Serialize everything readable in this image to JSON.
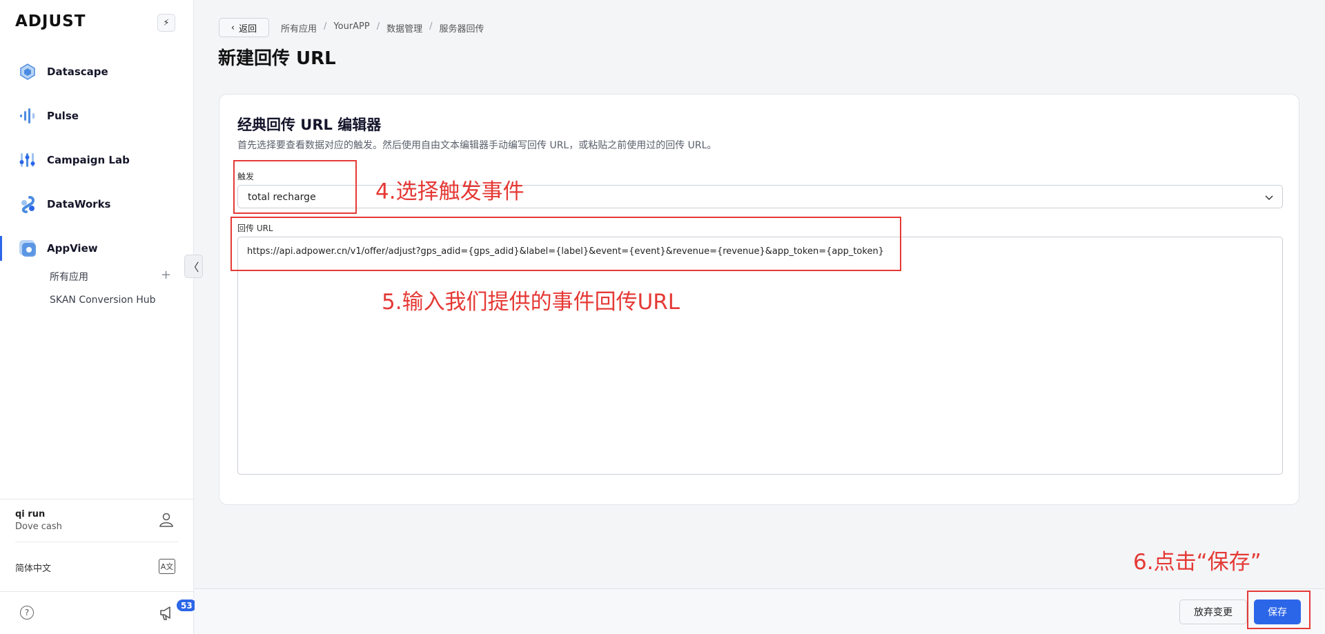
{
  "sidebar": {
    "logo": "ADJUST",
    "nav": [
      {
        "label": "Datascape",
        "icon": "datascape-icon"
      },
      {
        "label": "Pulse",
        "icon": "pulse-icon"
      },
      {
        "label": "Campaign Lab",
        "icon": "campaign-lab-icon"
      },
      {
        "label": "DataWorks",
        "icon": "dataworks-icon"
      },
      {
        "label": "AppView",
        "icon": "appview-icon"
      }
    ],
    "sub_items": [
      {
        "label": "所有应用"
      },
      {
        "label": "SKAN Conversion Hub"
      }
    ],
    "user": {
      "name": "qi run",
      "org": "Dove cash"
    },
    "language": "简体中文",
    "notification_count": "53"
  },
  "header": {
    "back_label": "返回",
    "breadcrumb": [
      "所有应用",
      "YourAPP",
      "数据管理",
      "服务器回传"
    ],
    "title": "新建回传 URL"
  },
  "editor": {
    "title": "经典回传 URL 编辑器",
    "description": "首先选择要查看数据对应的触发。然后使用自由文本编辑器手动编写回传 URL，或粘贴之前使用过的回传 URL。",
    "trigger_label": "触发",
    "trigger_value": "total recharge",
    "url_label": "回传 URL",
    "url_value": "https://api.adpower.cn/v1/offer/adjust?gps_adid={gps_adid}&label={label}&event={event}&revenue={revenue}&app_token={app_token}"
  },
  "annotations": {
    "step4": "4.选择触发事件",
    "step5": "5.输入我们提供的事件回传URL",
    "step6": "6.点击“保存”"
  },
  "footer": {
    "discard_label": "放弃变更",
    "save_label": "保存"
  },
  "colors": {
    "accent": "#2c66e8",
    "annotation": "#e53935"
  }
}
